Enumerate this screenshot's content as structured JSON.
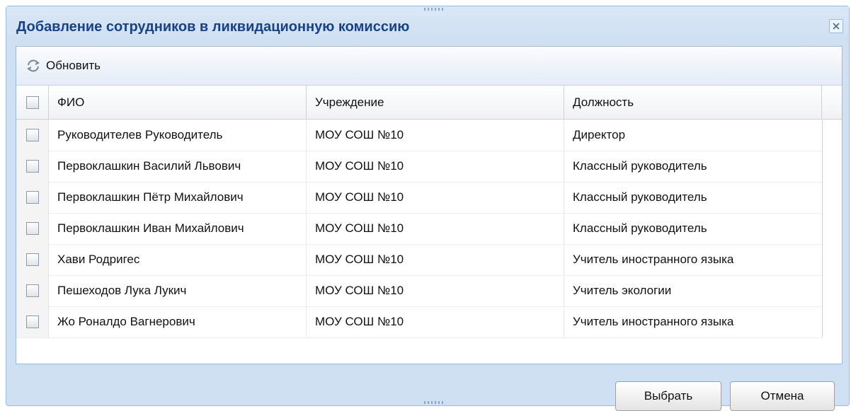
{
  "dialog": {
    "title": "Добавление сотрудников в ликвидационную комиссию",
    "close_icon": "close-icon"
  },
  "toolbar": {
    "refresh_label": "Обновить",
    "refresh_icon": "refresh-icon"
  },
  "grid": {
    "columns": {
      "fio": "ФИО",
      "org": "Учреждение",
      "position": "Должность"
    },
    "rows": [
      {
        "fio": "Руководителев Руководитель",
        "org": "МОУ СОШ №10",
        "position": "Директор"
      },
      {
        "fio": "Первоклашкин Василий Львович",
        "org": "МОУ СОШ №10",
        "position": "Классный руководитель"
      },
      {
        "fio": "Первоклашкин Пётр Михайлович",
        "org": "МОУ СОШ №10",
        "position": "Классный руководитель"
      },
      {
        "fio": "Первоклашкин Иван Михайлович",
        "org": "МОУ СОШ №10",
        "position": "Классный руководитель"
      },
      {
        "fio": "Хави Родригес",
        "org": "МОУ СОШ №10",
        "position": "Учитель иностранного языка"
      },
      {
        "fio": "Пешеходов Лука Лукич",
        "org": "МОУ СОШ №10",
        "position": "Учитель экологии"
      },
      {
        "fio": "Жо Роналдо Вагнерович",
        "org": "МОУ СОШ №10",
        "position": "Учитель иностранного языка"
      }
    ]
  },
  "footer": {
    "select_label": "Выбрать",
    "cancel_label": "Отмена"
  },
  "colors": {
    "title": "#15428b",
    "window_bg": "#cfe0f3",
    "border": "#99bbe8"
  }
}
